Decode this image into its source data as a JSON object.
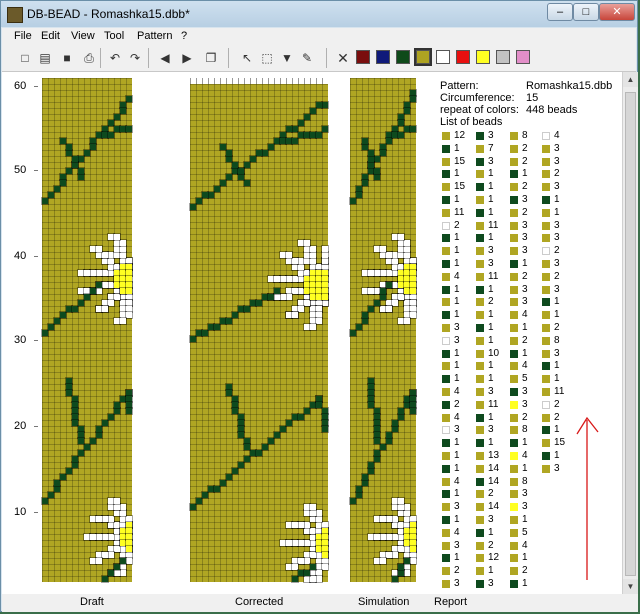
{
  "window": {
    "title": "DB-BEAD - Romashka15.dbb*",
    "minimize": "–",
    "maximize": "□",
    "close": "✕"
  },
  "menu": [
    "File",
    "Edit",
    "View",
    "Tool",
    "Pattern",
    "?"
  ],
  "toolbar": {
    "icons": [
      "new-icon",
      "open-icon",
      "save-icon",
      "print-icon",
      "undo-icon",
      "redo-icon",
      "prev-icon",
      "next-icon",
      "preview-icon",
      "pointer-icon",
      "select-icon",
      "fill-icon",
      "picker-icon"
    ],
    "glyphs": [
      "□",
      "▤",
      "■",
      "⎙",
      "↶",
      "↷",
      "◀",
      "▶",
      "❐",
      "↖",
      "⬚",
      "▼",
      "✎"
    ],
    "clear": "✕",
    "palette": [
      "#7a0e0e",
      "#101a7a",
      "#0f4a1a",
      "#aea322",
      "#ffffff",
      "#e81010",
      "#ffff22",
      "#c2c2c2",
      "#e28ec8"
    ]
  },
  "ruler": {
    "labels": [
      "60",
      "50",
      "40",
      "30",
      "20",
      "10"
    ]
  },
  "colors": {
    "background": "#b0a623",
    "dark_green": "#0e4a1e",
    "white": "#ffffff",
    "yellow": "#ffff22"
  },
  "tabs": [
    "Draft",
    "Corrected",
    "Simulation",
    "Report"
  ],
  "pattern": {
    "labels": {
      "pattern": "Pattern:",
      "circumference": "Circumference:",
      "repeat": "repeat of colors:",
      "list": "List of beads"
    },
    "values": {
      "pattern": "Romashka15.dbb",
      "circumference": "15",
      "repeat": "448 beads"
    }
  },
  "bead_list": [
    [
      [
        "o",
        "12"
      ],
      [
        "g",
        "3"
      ],
      [
        "o",
        "8"
      ],
      [
        "w",
        "4"
      ]
    ],
    [
      [
        "g",
        "1"
      ],
      [
        "o",
        "7"
      ],
      [
        "o",
        "2"
      ],
      [
        "o",
        "3"
      ]
    ],
    [
      [
        "o",
        "15"
      ],
      [
        "g",
        "3"
      ],
      [
        "o",
        "2"
      ],
      [
        "o",
        "3"
      ]
    ],
    [
      [
        "g",
        "1"
      ],
      [
        "o",
        "1"
      ],
      [
        "g",
        "1"
      ],
      [
        "o",
        "2"
      ]
    ],
    [
      [
        "o",
        "15"
      ],
      [
        "g",
        "1"
      ],
      [
        "o",
        "2"
      ],
      [
        "o",
        "3"
      ]
    ],
    [
      [
        "g",
        "1"
      ],
      [
        "o",
        "1"
      ],
      [
        "g",
        "3"
      ],
      [
        "g",
        "1"
      ]
    ],
    [
      [
        "o",
        "11"
      ],
      [
        "g",
        "1"
      ],
      [
        "o",
        "2"
      ],
      [
        "o",
        "1"
      ]
    ],
    [
      [
        "w",
        "2"
      ],
      [
        "o",
        "11"
      ],
      [
        "o",
        "3"
      ],
      [
        "o",
        "3"
      ]
    ],
    [
      [
        "g",
        "1"
      ],
      [
        "g",
        "1"
      ],
      [
        "o",
        "3"
      ],
      [
        "o",
        "3"
      ]
    ],
    [
      [
        "o",
        "1"
      ],
      [
        "o",
        "3"
      ],
      [
        "o",
        "3"
      ],
      [
        "w",
        "2"
      ]
    ],
    [
      [
        "g",
        "1"
      ],
      [
        "o",
        "3"
      ],
      [
        "g",
        "1"
      ],
      [
        "o",
        "3"
      ]
    ],
    [
      [
        "o",
        "4"
      ],
      [
        "o",
        "11"
      ],
      [
        "o",
        "2"
      ],
      [
        "o",
        "2"
      ]
    ],
    [
      [
        "g",
        "1"
      ],
      [
        "g",
        "1"
      ],
      [
        "o",
        "3"
      ],
      [
        "o",
        "3"
      ]
    ],
    [
      [
        "o",
        "1"
      ],
      [
        "o",
        "2"
      ],
      [
        "o",
        "3"
      ],
      [
        "g",
        "1"
      ]
    ],
    [
      [
        "g",
        "1"
      ],
      [
        "o",
        "1"
      ],
      [
        "o",
        "4"
      ],
      [
        "o",
        "1"
      ]
    ],
    [
      [
        "o",
        "3"
      ],
      [
        "g",
        "1"
      ],
      [
        "o",
        "1"
      ],
      [
        "o",
        "2"
      ]
    ],
    [
      [
        "w",
        "3"
      ],
      [
        "o",
        "1"
      ],
      [
        "o",
        "2"
      ],
      [
        "o",
        "8"
      ]
    ],
    [
      [
        "g",
        "1"
      ],
      [
        "o",
        "10"
      ],
      [
        "g",
        "1"
      ],
      [
        "o",
        "3"
      ]
    ],
    [
      [
        "o",
        "1"
      ],
      [
        "o",
        "1"
      ],
      [
        "o",
        "4"
      ],
      [
        "g",
        "1"
      ]
    ],
    [
      [
        "g",
        "1"
      ],
      [
        "o",
        "1"
      ],
      [
        "o",
        "5"
      ],
      [
        "o",
        "1"
      ]
    ],
    [
      [
        "o",
        "4"
      ],
      [
        "o",
        "3"
      ],
      [
        "g",
        "3"
      ],
      [
        "o",
        "11"
      ]
    ],
    [
      [
        "g",
        "2"
      ],
      [
        "o",
        "11"
      ],
      [
        "y",
        "3"
      ],
      [
        "w",
        "2"
      ]
    ],
    [
      [
        "o",
        "4"
      ],
      [
        "g",
        "1"
      ],
      [
        "o",
        "2"
      ],
      [
        "o",
        "2"
      ]
    ],
    [
      [
        "w",
        "3"
      ],
      [
        "o",
        "3"
      ],
      [
        "o",
        "8"
      ],
      [
        "g",
        "1"
      ]
    ],
    [
      [
        "g",
        "1"
      ],
      [
        "g",
        "1"
      ],
      [
        "g",
        "1"
      ],
      [
        "o",
        "15"
      ]
    ],
    [
      [
        "o",
        "1"
      ],
      [
        "o",
        "13"
      ],
      [
        "y",
        "4"
      ],
      [
        "g",
        "1"
      ]
    ],
    [
      [
        "g",
        "1"
      ],
      [
        "o",
        "14"
      ],
      [
        "o",
        "1"
      ],
      [
        "o",
        "3"
      ]
    ],
    [
      [
        "o",
        "4"
      ],
      [
        "g",
        "14"
      ],
      [
        "o",
        "8"
      ],
      null
    ],
    [
      [
        "g",
        "1"
      ],
      [
        "o",
        "2"
      ],
      [
        "o",
        "3"
      ],
      null
    ],
    [
      [
        "o",
        "3"
      ],
      [
        "o",
        "14"
      ],
      [
        "y",
        "3"
      ],
      null
    ],
    [
      [
        "g",
        "1"
      ],
      [
        "o",
        "3"
      ],
      [
        "o",
        "1"
      ],
      null
    ],
    [
      [
        "o",
        "4"
      ],
      [
        "g",
        "1"
      ],
      [
        "o",
        "5"
      ],
      null
    ],
    [
      [
        "o",
        "3"
      ],
      [
        "o",
        "2"
      ],
      [
        "o",
        "4"
      ],
      null
    ],
    [
      [
        "g",
        "1"
      ],
      [
        "o",
        "12"
      ],
      [
        "o",
        "1"
      ],
      null
    ],
    [
      [
        "o",
        "2"
      ],
      [
        "o",
        "1"
      ],
      [
        "o",
        "2"
      ],
      null
    ],
    [
      [
        "o",
        "3"
      ],
      [
        "g",
        "3"
      ],
      [
        "g",
        "1"
      ],
      null
    ]
  ]
}
